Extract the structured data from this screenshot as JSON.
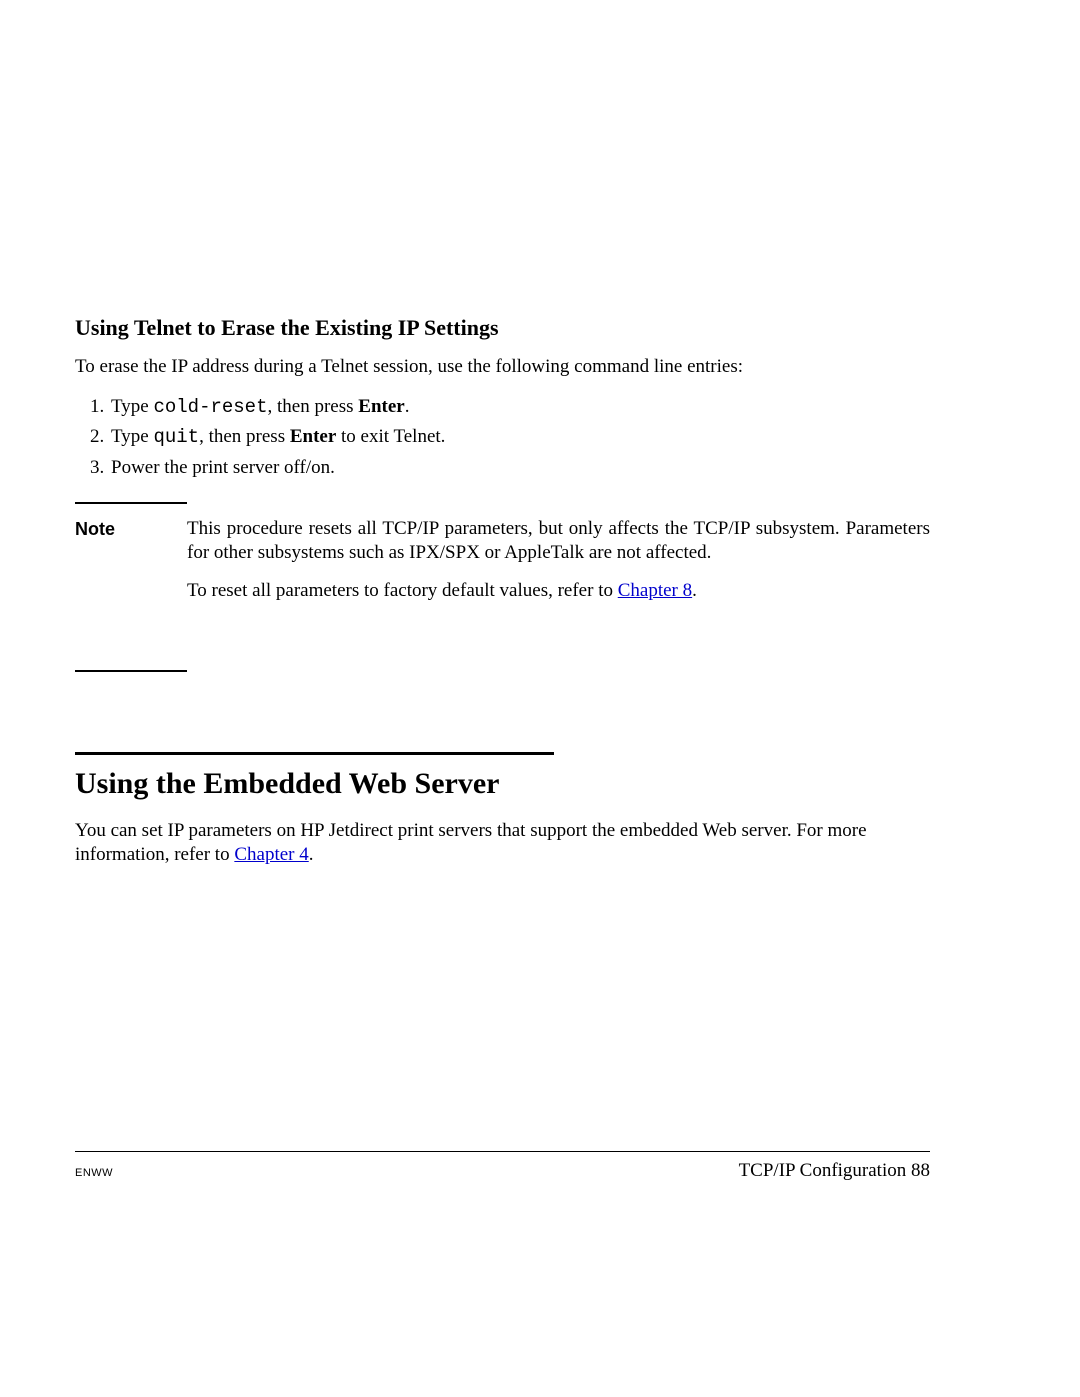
{
  "section1": {
    "heading": "Using Telnet to Erase the Existing IP Settings",
    "intro": "To erase the IP address during a Telnet session, use the following command line entries:",
    "steps": [
      {
        "pre": "Type ",
        "code": "cold-reset",
        "mid": ", then press ",
        "bold": "Enter",
        "post": "."
      },
      {
        "pre": "Type ",
        "code": "quit",
        "mid": ", then press ",
        "bold": "Enter",
        "post": " to exit Telnet."
      },
      {
        "pre": "Power the print server off/on.",
        "code": "",
        "mid": "",
        "bold": "",
        "post": ""
      }
    ]
  },
  "note": {
    "label": "Note",
    "p1": "This procedure resets all TCP/IP parameters, but only affects the TCP/IP subsystem. Parameters for other subsystems such as IPX/SPX or AppleTalk are not affected.",
    "p2_pre": "To reset all parameters to factory default values, refer to ",
    "p2_link": "Chapter 8",
    "p2_post": "."
  },
  "section2": {
    "heading": "Using the Embedded Web Server",
    "body_pre": "You can set IP parameters on HP Jetdirect print servers that support the embedded Web server. For more information, refer to ",
    "body_link": "Chapter 4",
    "body_post": "."
  },
  "footer": {
    "left": "ENWW",
    "right": "TCP/IP Configuration 88"
  }
}
